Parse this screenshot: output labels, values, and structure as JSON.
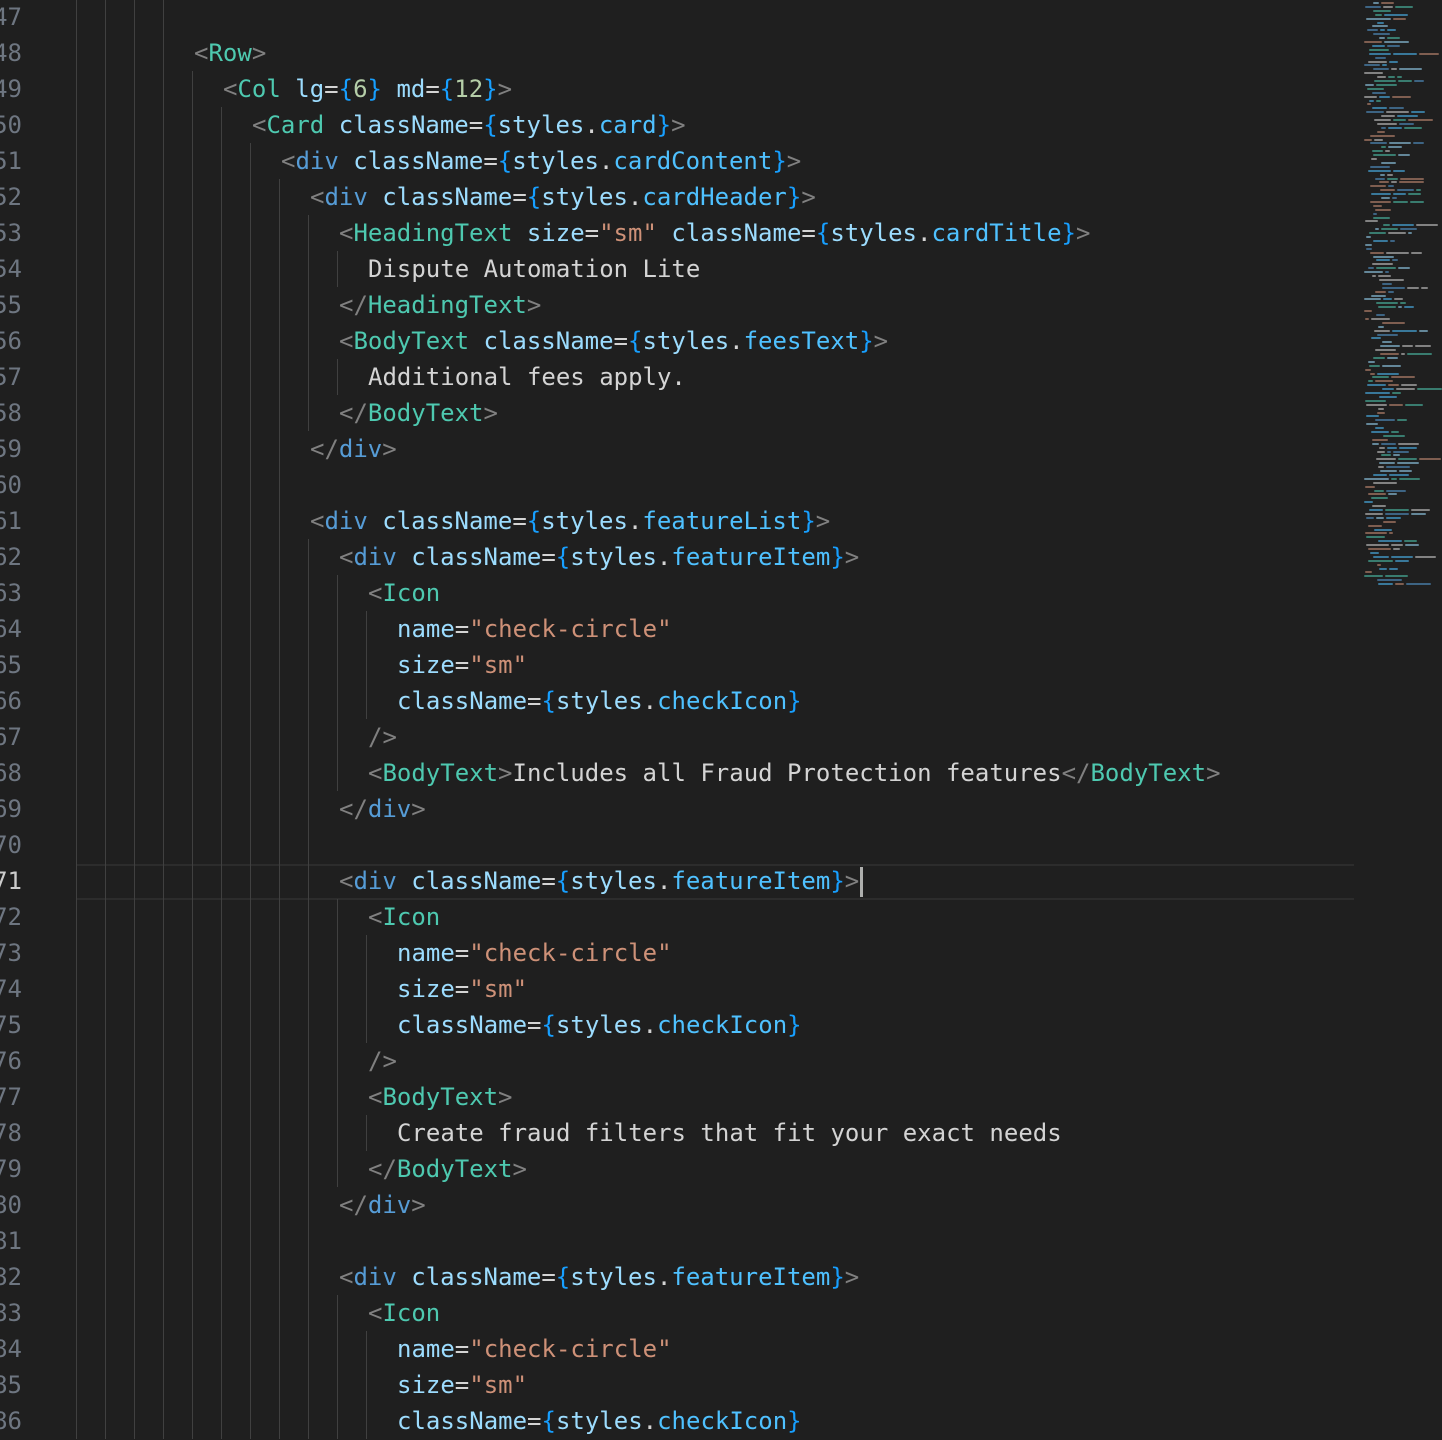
{
  "editor": {
    "active_line": 71,
    "lines": [
      {
        "n": "47",
        "indent": 0,
        "tokens": []
      },
      {
        "n": "48",
        "indent": 4,
        "tokens": [
          [
            "punc",
            "<"
          ],
          [
            "tag",
            "Row"
          ],
          [
            "punc",
            ">"
          ]
        ]
      },
      {
        "n": "49",
        "indent": 5,
        "tokens": [
          [
            "punc",
            "<"
          ],
          [
            "tag",
            "Col"
          ],
          [
            "text",
            " "
          ],
          [
            "attr",
            "lg"
          ],
          [
            "op",
            "="
          ],
          [
            "brace",
            "{"
          ],
          [
            "num",
            "6"
          ],
          [
            "brace",
            "}"
          ],
          [
            "text",
            " "
          ],
          [
            "attr",
            "md"
          ],
          [
            "op",
            "="
          ],
          [
            "brace",
            "{"
          ],
          [
            "num",
            "12"
          ],
          [
            "brace",
            "}"
          ],
          [
            "punc",
            ">"
          ]
        ]
      },
      {
        "n": "50",
        "indent": 6,
        "tokens": [
          [
            "punc",
            "<"
          ],
          [
            "tag",
            "Card"
          ],
          [
            "text",
            " "
          ],
          [
            "attr",
            "className"
          ],
          [
            "op",
            "="
          ],
          [
            "brace",
            "{"
          ],
          [
            "var",
            "styles"
          ],
          [
            "op",
            "."
          ],
          [
            "prop",
            "card"
          ],
          [
            "brace",
            "}"
          ],
          [
            "punc",
            ">"
          ]
        ]
      },
      {
        "n": "51",
        "indent": 7,
        "tokens": [
          [
            "punc",
            "<"
          ],
          [
            "html",
            "div"
          ],
          [
            "text",
            " "
          ],
          [
            "attr",
            "className"
          ],
          [
            "op",
            "="
          ],
          [
            "brace",
            "{"
          ],
          [
            "var",
            "styles"
          ],
          [
            "op",
            "."
          ],
          [
            "prop",
            "cardContent"
          ],
          [
            "brace",
            "}"
          ],
          [
            "punc",
            ">"
          ]
        ]
      },
      {
        "n": "52",
        "indent": 8,
        "tokens": [
          [
            "punc",
            "<"
          ],
          [
            "html",
            "div"
          ],
          [
            "text",
            " "
          ],
          [
            "attr",
            "className"
          ],
          [
            "op",
            "="
          ],
          [
            "brace",
            "{"
          ],
          [
            "var",
            "styles"
          ],
          [
            "op",
            "."
          ],
          [
            "prop",
            "cardHeader"
          ],
          [
            "brace",
            "}"
          ],
          [
            "punc",
            ">"
          ]
        ]
      },
      {
        "n": "53",
        "indent": 9,
        "tokens": [
          [
            "punc",
            "<"
          ],
          [
            "tag",
            "HeadingText"
          ],
          [
            "text",
            " "
          ],
          [
            "attr",
            "size"
          ],
          [
            "op",
            "="
          ],
          [
            "str",
            "\"sm\""
          ],
          [
            "text",
            " "
          ],
          [
            "attr",
            "className"
          ],
          [
            "op",
            "="
          ],
          [
            "brace",
            "{"
          ],
          [
            "var",
            "styles"
          ],
          [
            "op",
            "."
          ],
          [
            "prop",
            "cardTitle"
          ],
          [
            "brace",
            "}"
          ],
          [
            "punc",
            ">"
          ]
        ]
      },
      {
        "n": "54",
        "indent": 10,
        "tokens": [
          [
            "text",
            "Dispute Automation Lite"
          ]
        ]
      },
      {
        "n": "55",
        "indent": 9,
        "tokens": [
          [
            "punc",
            "</"
          ],
          [
            "tag",
            "HeadingText"
          ],
          [
            "punc",
            ">"
          ]
        ]
      },
      {
        "n": "56",
        "indent": 9,
        "tokens": [
          [
            "punc",
            "<"
          ],
          [
            "tag",
            "BodyText"
          ],
          [
            "text",
            " "
          ],
          [
            "attr",
            "className"
          ],
          [
            "op",
            "="
          ],
          [
            "brace",
            "{"
          ],
          [
            "var",
            "styles"
          ],
          [
            "op",
            "."
          ],
          [
            "prop",
            "feesText"
          ],
          [
            "brace",
            "}"
          ],
          [
            "punc",
            ">"
          ]
        ]
      },
      {
        "n": "57",
        "indent": 10,
        "tokens": [
          [
            "text",
            "Additional fees apply."
          ]
        ]
      },
      {
        "n": "58",
        "indent": 9,
        "tokens": [
          [
            "punc",
            "</"
          ],
          [
            "tag",
            "BodyText"
          ],
          [
            "punc",
            ">"
          ]
        ]
      },
      {
        "n": "59",
        "indent": 8,
        "tokens": [
          [
            "punc",
            "</"
          ],
          [
            "html",
            "div"
          ],
          [
            "punc",
            ">"
          ]
        ]
      },
      {
        "n": "60",
        "indent": 0,
        "tokens": []
      },
      {
        "n": "61",
        "indent": 8,
        "tokens": [
          [
            "punc",
            "<"
          ],
          [
            "html",
            "div"
          ],
          [
            "text",
            " "
          ],
          [
            "attr",
            "className"
          ],
          [
            "op",
            "="
          ],
          [
            "brace",
            "{"
          ],
          [
            "var",
            "styles"
          ],
          [
            "op",
            "."
          ],
          [
            "prop",
            "featureList"
          ],
          [
            "brace",
            "}"
          ],
          [
            "punc",
            ">"
          ]
        ]
      },
      {
        "n": "62",
        "indent": 9,
        "tokens": [
          [
            "punc",
            "<"
          ],
          [
            "html",
            "div"
          ],
          [
            "text",
            " "
          ],
          [
            "attr",
            "className"
          ],
          [
            "op",
            "="
          ],
          [
            "brace",
            "{"
          ],
          [
            "var",
            "styles"
          ],
          [
            "op",
            "."
          ],
          [
            "prop",
            "featureItem"
          ],
          [
            "brace",
            "}"
          ],
          [
            "punc",
            ">"
          ]
        ]
      },
      {
        "n": "63",
        "indent": 10,
        "tokens": [
          [
            "punc",
            "<"
          ],
          [
            "tag",
            "Icon"
          ]
        ]
      },
      {
        "n": "64",
        "indent": 11,
        "tokens": [
          [
            "attr",
            "name"
          ],
          [
            "op",
            "="
          ],
          [
            "str",
            "\"check-circle\""
          ]
        ]
      },
      {
        "n": "65",
        "indent": 11,
        "tokens": [
          [
            "attr",
            "size"
          ],
          [
            "op",
            "="
          ],
          [
            "str",
            "\"sm\""
          ]
        ]
      },
      {
        "n": "66",
        "indent": 11,
        "tokens": [
          [
            "attr",
            "className"
          ],
          [
            "op",
            "="
          ],
          [
            "brace",
            "{"
          ],
          [
            "var",
            "styles"
          ],
          [
            "op",
            "."
          ],
          [
            "prop",
            "checkIcon"
          ],
          [
            "brace",
            "}"
          ]
        ]
      },
      {
        "n": "67",
        "indent": 10,
        "tokens": [
          [
            "punc",
            "/>"
          ]
        ]
      },
      {
        "n": "68",
        "indent": 10,
        "tokens": [
          [
            "punc",
            "<"
          ],
          [
            "tag",
            "BodyText"
          ],
          [
            "punc",
            ">"
          ],
          [
            "text",
            "Includes all Fraud Protection features"
          ],
          [
            "punc",
            "</"
          ],
          [
            "tag",
            "BodyText"
          ],
          [
            "punc",
            ">"
          ]
        ]
      },
      {
        "n": "69",
        "indent": 9,
        "tokens": [
          [
            "punc",
            "</"
          ],
          [
            "html",
            "div"
          ],
          [
            "punc",
            ">"
          ]
        ]
      },
      {
        "n": "70",
        "indent": 0,
        "tokens": []
      },
      {
        "n": "71",
        "indent": 9,
        "caret": true,
        "tokens": [
          [
            "punc",
            "<"
          ],
          [
            "html",
            "div"
          ],
          [
            "text",
            " "
          ],
          [
            "attr",
            "className"
          ],
          [
            "op",
            "="
          ],
          [
            "brace",
            "{"
          ],
          [
            "var",
            "styles"
          ],
          [
            "op",
            "."
          ],
          [
            "prop",
            "featureItem"
          ],
          [
            "brace",
            "}"
          ],
          [
            "punc",
            ">"
          ]
        ]
      },
      {
        "n": "72",
        "indent": 10,
        "tokens": [
          [
            "punc",
            "<"
          ],
          [
            "tag",
            "Icon"
          ]
        ]
      },
      {
        "n": "73",
        "indent": 11,
        "tokens": [
          [
            "attr",
            "name"
          ],
          [
            "op",
            "="
          ],
          [
            "str",
            "\"check-circle\""
          ]
        ]
      },
      {
        "n": "74",
        "indent": 11,
        "tokens": [
          [
            "attr",
            "size"
          ],
          [
            "op",
            "="
          ],
          [
            "str",
            "\"sm\""
          ]
        ]
      },
      {
        "n": "75",
        "indent": 11,
        "tokens": [
          [
            "attr",
            "className"
          ],
          [
            "op",
            "="
          ],
          [
            "brace",
            "{"
          ],
          [
            "var",
            "styles"
          ],
          [
            "op",
            "."
          ],
          [
            "prop",
            "checkIcon"
          ],
          [
            "brace",
            "}"
          ]
        ]
      },
      {
        "n": "76",
        "indent": 10,
        "tokens": [
          [
            "punc",
            "/>"
          ]
        ]
      },
      {
        "n": "77",
        "indent": 10,
        "tokens": [
          [
            "punc",
            "<"
          ],
          [
            "tag",
            "BodyText"
          ],
          [
            "punc",
            ">"
          ]
        ]
      },
      {
        "n": "78",
        "indent": 11,
        "tokens": [
          [
            "text",
            "Create fraud filters that fit your exact needs"
          ]
        ]
      },
      {
        "n": "79",
        "indent": 10,
        "tokens": [
          [
            "punc",
            "</"
          ],
          [
            "tag",
            "BodyText"
          ],
          [
            "punc",
            ">"
          ]
        ]
      },
      {
        "n": "80",
        "indent": 9,
        "tokens": [
          [
            "punc",
            "</"
          ],
          [
            "html",
            "div"
          ],
          [
            "punc",
            ">"
          ]
        ]
      },
      {
        "n": "81",
        "indent": 0,
        "tokens": []
      },
      {
        "n": "82",
        "indent": 9,
        "tokens": [
          [
            "punc",
            "<"
          ],
          [
            "html",
            "div"
          ],
          [
            "text",
            " "
          ],
          [
            "attr",
            "className"
          ],
          [
            "op",
            "="
          ],
          [
            "brace",
            "{"
          ],
          [
            "var",
            "styles"
          ],
          [
            "op",
            "."
          ],
          [
            "prop",
            "featureItem"
          ],
          [
            "brace",
            "}"
          ],
          [
            "punc",
            ">"
          ]
        ]
      },
      {
        "n": "83",
        "indent": 10,
        "tokens": [
          [
            "punc",
            "<"
          ],
          [
            "tag",
            "Icon"
          ]
        ]
      },
      {
        "n": "84",
        "indent": 11,
        "tokens": [
          [
            "attr",
            "name"
          ],
          [
            "op",
            "="
          ],
          [
            "str",
            "\"check-circle\""
          ]
        ]
      },
      {
        "n": "85",
        "indent": 11,
        "tokens": [
          [
            "attr",
            "size"
          ],
          [
            "op",
            "="
          ],
          [
            "str",
            "\"sm\""
          ]
        ]
      },
      {
        "n": "86",
        "indent": 11,
        "tokens": [
          [
            "attr",
            "className"
          ],
          [
            "op",
            "="
          ],
          [
            "brace",
            "{"
          ],
          [
            "var",
            "styles"
          ],
          [
            "op",
            "."
          ],
          [
            "prop",
            "checkIcon"
          ],
          [
            "brace",
            "}"
          ]
        ]
      }
    ]
  },
  "theme": {
    "background": "#1f1f1f",
    "line_number": "#6e7681",
    "line_number_active": "#cccccc",
    "tag": "#4ec9b0",
    "html_tag": "#569cd6",
    "attribute": "#9cdcfe",
    "string": "#ce9178",
    "brace": "#179fff",
    "number": "#b5cea8",
    "property": "#4fc1ff",
    "punctuation": "#808080",
    "text": "#d4d4d4"
  }
}
